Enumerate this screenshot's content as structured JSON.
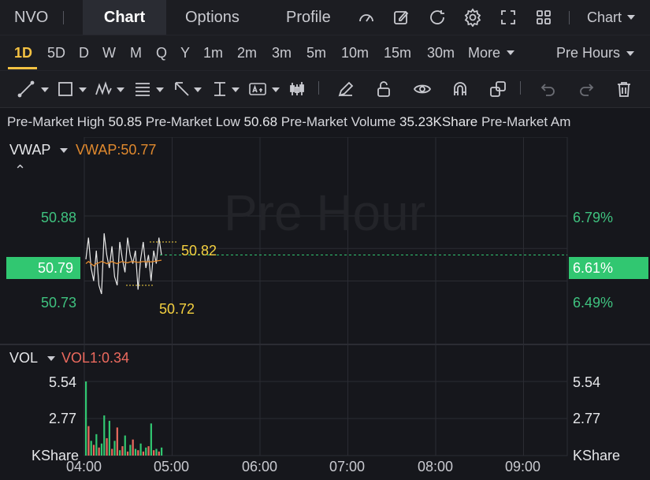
{
  "header": {
    "symbol": "NVO",
    "tabs": [
      "Chart",
      "Options",
      "Profile"
    ],
    "active_tab": "Chart",
    "chart_menu_label": "Chart"
  },
  "timeframes": {
    "items": [
      "1D",
      "5D",
      "D",
      "W",
      "M",
      "Q",
      "Y",
      "1m",
      "2m",
      "3m",
      "5m",
      "10m",
      "15m",
      "30m"
    ],
    "active": "1D",
    "more_label": "More",
    "session_label": "Pre Hours"
  },
  "info_bar": {
    "items": [
      {
        "label": "Pre-Market High",
        "value": "50.85"
      },
      {
        "label": "Pre-Market Low",
        "value": "50.68"
      },
      {
        "label": "Pre-Market Volume",
        "value": "35.23KShare"
      },
      {
        "label": "Pre-Market Am",
        "value": ""
      }
    ]
  },
  "price_panel": {
    "indicator_name": "VWAP",
    "indicator_value": "VWAP:50.77",
    "watermark": "Pre Hour",
    "left_axis": [
      "50.88",
      "50.73"
    ],
    "right_axis": [
      "6.79%",
      "6.49%"
    ],
    "current_price": "50.79",
    "current_pct": "6.61%",
    "high_label": "50.82",
    "low_label": "50.72",
    "colors": {
      "price_line": "#e8e8e8",
      "vwap_line": "#e0892e",
      "axis_green": "#3fc27f",
      "marker": "#f4d03f"
    }
  },
  "volume_panel": {
    "indicator_name": "VOL",
    "indicator_value": "VOL1:0.34",
    "left_axis": [
      "5.54",
      "2.77",
      "KShare"
    ],
    "right_axis": [
      "5.54",
      "2.77",
      "KShare"
    ]
  },
  "time_axis": [
    "04:00",
    "05:00",
    "06:00",
    "07:00",
    "08:00",
    "09:00"
  ],
  "chart_data": {
    "type": "line",
    "x_range": [
      "04:00",
      "09:30"
    ],
    "ylim": [
      50.68,
      50.88
    ],
    "series": [
      {
        "values": [
          50.78,
          50.83,
          50.76,
          50.73,
          50.8,
          50.72,
          50.7,
          50.84,
          50.79,
          50.76,
          50.81,
          50.74,
          50.72,
          50.82,
          50.78,
          50.75,
          50.83,
          50.79,
          50.77,
          50.8,
          50.71,
          50.78,
          50.82,
          50.76,
          50.79,
          50.73,
          50.8,
          50.77,
          50.83,
          50.79
        ]
      },
      {
        "values": [
          50.77,
          50.775,
          50.77,
          50.765,
          50.77,
          50.772,
          50.775,
          50.773,
          50.77,
          50.772,
          50.775,
          50.772,
          50.77,
          50.773,
          50.775,
          50.773,
          50.772,
          50.774,
          50.775,
          50.774,
          50.773,
          50.774,
          50.775,
          50.774,
          50.775,
          50.774,
          50.775,
          50.776,
          50.777,
          50.778
        ]
      }
    ],
    "volume": {
      "ylim": [
        0,
        5.54
      ],
      "values": [
        5.54,
        2.2,
        1.1,
        0.8,
        1.6,
        0.6,
        0.9,
        3.0,
        1.3,
        2.6,
        0.5,
        1.1,
        2.1,
        0.4,
        0.7,
        1.5,
        0.3,
        0.8,
        1.2,
        0.5,
        0.4,
        0.9,
        0.3,
        0.6,
        0.7,
        2.4,
        0.4,
        0.5,
        0.3,
        0.6
      ],
      "colors": [
        "#31c771",
        "#ec6a5e",
        "#31c771",
        "#ec6a5e",
        "#31c771",
        "#ec6a5e",
        "#31c771",
        "#31c771",
        "#ec6a5e",
        "#31c771",
        "#ec6a5e",
        "#31c771",
        "#ec6a5e",
        "#31c771",
        "#ec6a5e",
        "#31c771",
        "#ec6a5e",
        "#31c771",
        "#ec6a5e",
        "#31c771",
        "#ec6a5e",
        "#31c771",
        "#ec6a5e",
        "#31c771",
        "#ec6a5e",
        "#31c771",
        "#ec6a5e",
        "#31c771",
        "#ec6a5e",
        "#31c771"
      ]
    },
    "grid": true
  }
}
